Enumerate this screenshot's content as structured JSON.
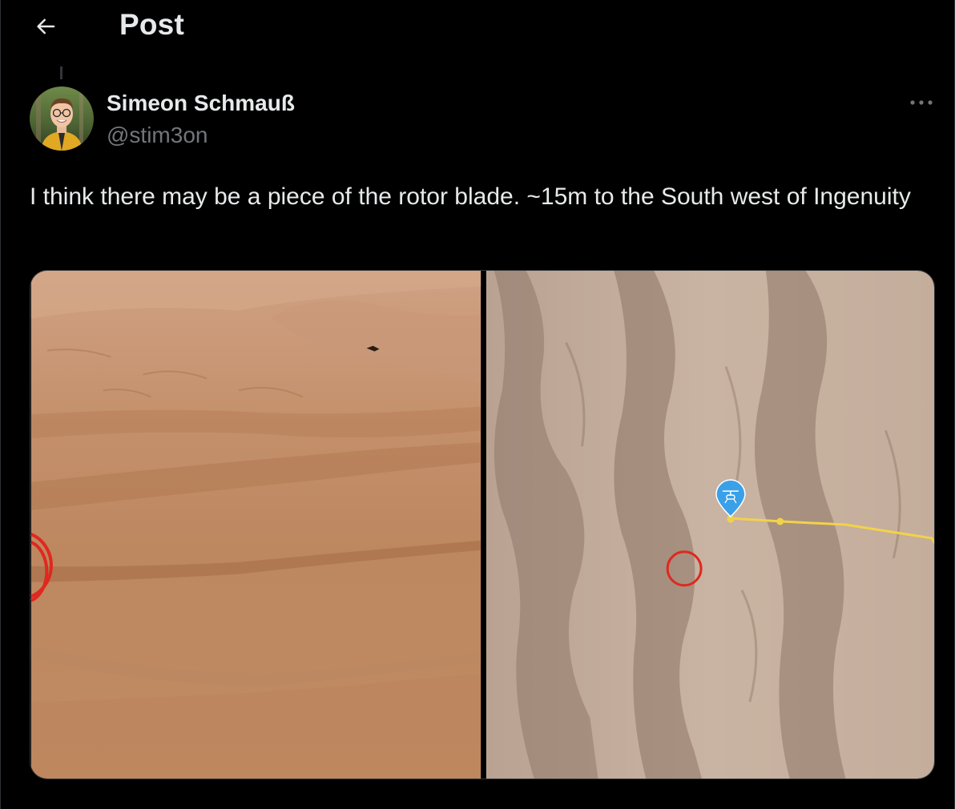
{
  "header": {
    "title": "Post",
    "back_icon": "arrow-left-icon"
  },
  "post": {
    "author": {
      "name": "Simeon Schmauß",
      "handle": "@stim3on",
      "avatar_icon": "avatar-photo"
    },
    "more_icon": "more-horizontal-icon",
    "text": "I think there may be a piece of the rotor blade. ~15m to the South west of Ingenuity",
    "media": [
      {
        "kind": "photo",
        "subject": "sand dunes with partial red circle marker"
      },
      {
        "kind": "photo",
        "subject": "orbital dune map with helicopter pin, yellow flight path and red circle marker"
      }
    ]
  },
  "colors": {
    "background": "#000000",
    "text_primary": "#e7e9ea",
    "text_secondary": "#71767b",
    "border": "#2f3336",
    "marker_red": "#e0281f",
    "path_yellow": "#f2d24a",
    "pin_blue": "#3aa0e8"
  }
}
